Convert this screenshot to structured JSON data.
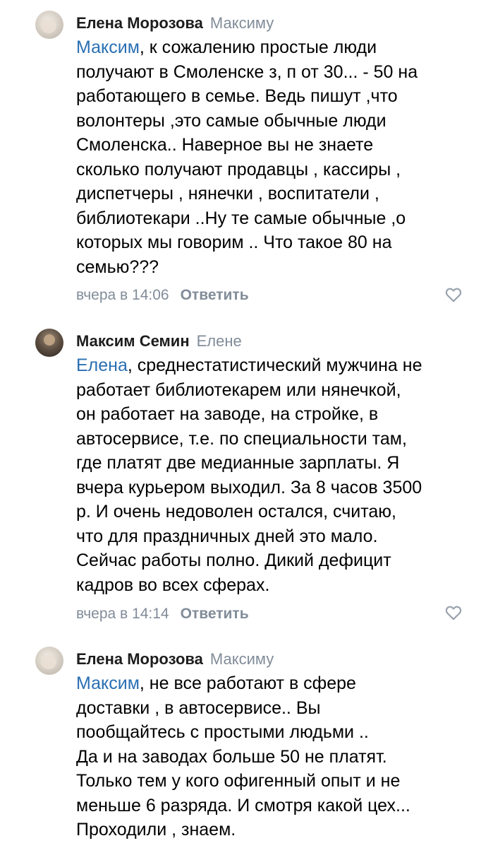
{
  "comments": [
    {
      "author": "Елена Морозова",
      "reply_to": "Максиму",
      "mention": "Максим",
      "text": ", к сожалению простые люди\nполучают в Смоленске з, п от 30... - 50 на\nработающего в семье.   Ведь пишут ,что\nволонтеры ,это самые обычные люди\nСмоленска.. Наверное вы не знаете\nсколько получают продавцы , кассиры ,\nдиспетчеры , нянечки , воспитатели ,\nбиблиотекари ..Ну те самые обычные ,о\nкоторых мы говорим .. Что такое 80 на\nсемью???",
      "time": "вчера в 14:06",
      "reply_label": "Ответить",
      "like_icon": "heart-outline-icon"
    },
    {
      "author": "Максим Семин",
      "reply_to": "Елене",
      "mention": "Елена",
      "text": ", среднестатистический мужчина не\nработает библиотекарем или нянечкой,\nон работает на заводе, на стройке, в\nавтосервисе, т.е. по специальности там,\nгде платят две медианные зарплаты. Я\nвчера курьером выходил. За 8 часов 3500\nр. И очень недоволен остался, считаю,\nчто для праздничных дней это мало.\nСейчас работы полно. Дикий дефицит\nкадров во всех сферах.",
      "time": "вчера в 14:14",
      "reply_label": "Ответить",
      "like_icon": "heart-outline-icon"
    },
    {
      "author": "Елена Морозова",
      "reply_to": "Максиму",
      "mention": "Максим",
      "text": ", не все работают в сфере\nдоставки , в автосервисе.. Вы\nпообщайтесь с простыми людьми ..\nДа и  на заводах больше 50 не платят.\nТолько тем у кого офигенный опыт и не\nменьше 6 разряда. И смотря какой цех...\nПроходили , знаем."
    }
  ],
  "colors": {
    "mention": "#2a6fb3",
    "secondary": "#818c99",
    "author": "#1d1d1d"
  }
}
